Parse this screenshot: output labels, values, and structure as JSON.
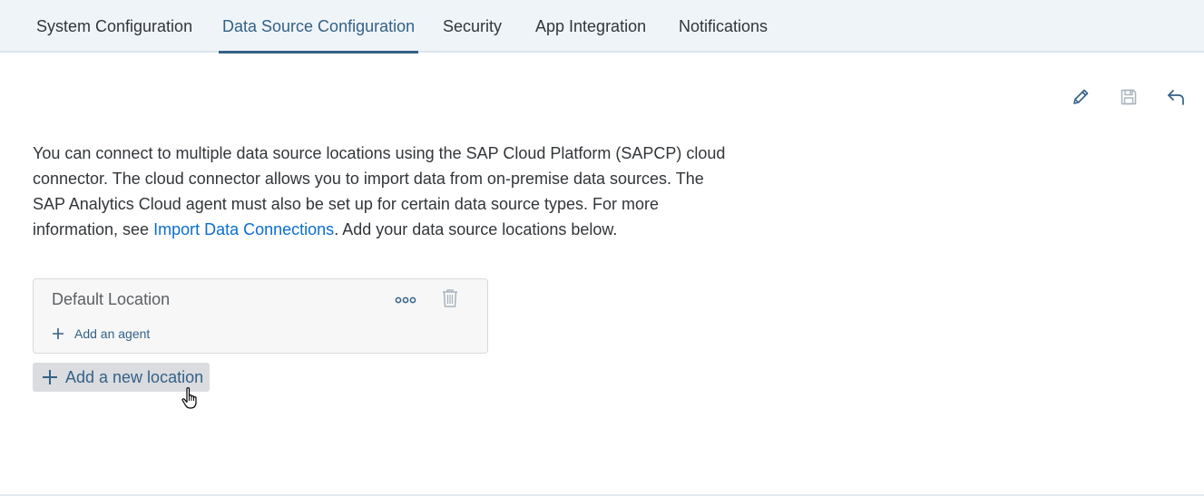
{
  "tabs": [
    {
      "label": "System Configuration",
      "active": false
    },
    {
      "label": "Data Source Configuration",
      "active": true
    },
    {
      "label": "Security",
      "active": false
    },
    {
      "label": "App Integration",
      "active": false
    },
    {
      "label": "Notifications",
      "active": false
    }
  ],
  "toolbar": {
    "edit_icon": "pencil-icon",
    "save_icon": "save-icon",
    "undo_icon": "undo-icon"
  },
  "description": {
    "text_before": "You can connect to multiple data source locations using the SAP Cloud Platform (SAPCP) cloud connector. The cloud connector allows you to import data from on-premise data sources. The SAP Analytics Cloud agent must also be set up for certain data source types. For more information, see ",
    "link_text": "Import Data Connections",
    "text_after": ". Add your data source locations below."
  },
  "location": {
    "title": "Default Location",
    "more_icon": "more-horizontal-icon",
    "delete_icon": "trash-icon",
    "add_agent_label": "Add an agent"
  },
  "add_location_label": "Add a new location",
  "colors": {
    "accent": "#346187",
    "link": "#0a6ed1",
    "tabbar_bg": "#eff4f9",
    "text": "#32363a"
  }
}
